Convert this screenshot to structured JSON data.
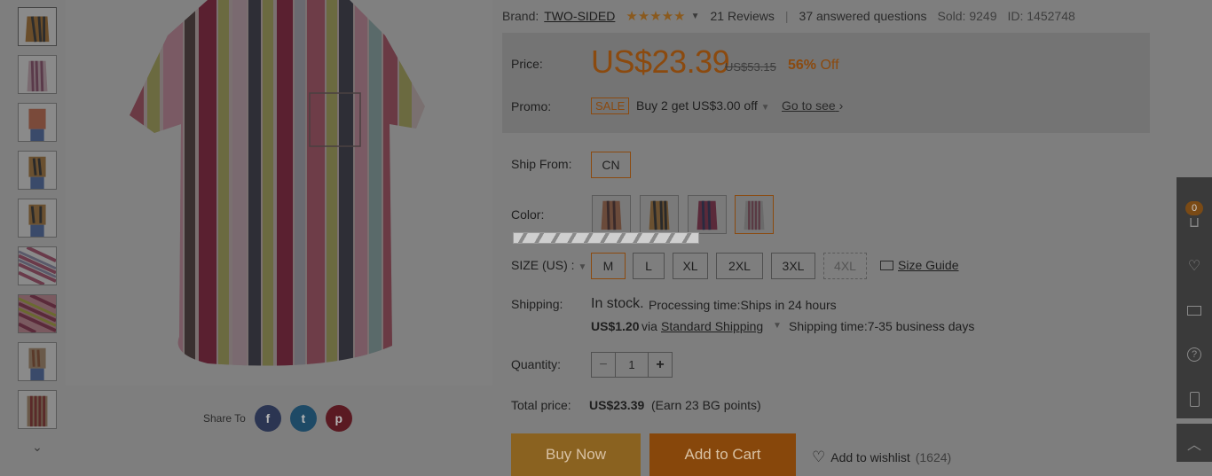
{
  "brand": {
    "label": "Brand:",
    "name": "TWO-SIDED"
  },
  "rating": {
    "stars": "★★★★★",
    "reviews": "21 Reviews",
    "questions": "37 answered questions",
    "sold": "Sold: 9249",
    "id": "ID: 1452748"
  },
  "price": {
    "label": "Price:",
    "current": "US$23.39",
    "original": "US$53.15",
    "discount_pct": "56%",
    "discount_word": "Off"
  },
  "promo": {
    "label": "Promo:",
    "tag": "SALE",
    "text": "Buy 2 get US$3.00 off",
    "link": "Go to see"
  },
  "ship_from": {
    "label": "Ship From:",
    "value": "CN"
  },
  "color": {
    "label": "Color:"
  },
  "size": {
    "label": "SIZE (US) :",
    "options": [
      "M",
      "L",
      "XL",
      "2XL",
      "3XL",
      "4XL"
    ],
    "guide": "Size Guide"
  },
  "shipping": {
    "label": "Shipping:",
    "stock": "In stock.",
    "processing": "Processing time:Ships in 24 hours",
    "cost": "US$1.20",
    "via": "via",
    "method": "Standard Shipping",
    "time": "Shipping time:7-35 business days"
  },
  "quantity": {
    "label": "Quantity:",
    "value": "1",
    "minus": "−",
    "plus": "+"
  },
  "total": {
    "label": "Total price:",
    "value": "US$23.39",
    "points": "(Earn 23 BG points)"
  },
  "actions": {
    "buy_now": "Buy Now",
    "add_to_cart": "Add to Cart",
    "wishlist": "Add to wishlist",
    "wishlist_count": "(1624)"
  },
  "share": {
    "label": "Share To",
    "facebook": "f",
    "twitter": "t",
    "pinterest": "p"
  },
  "sidebar": {
    "cart_count": "0"
  },
  "colors": {
    "accent": "#8b4a0f",
    "overlay_bg": "#7e7e7e",
    "buy_now_bg": "#8a6220",
    "add_cart_bg": "#87470b"
  }
}
